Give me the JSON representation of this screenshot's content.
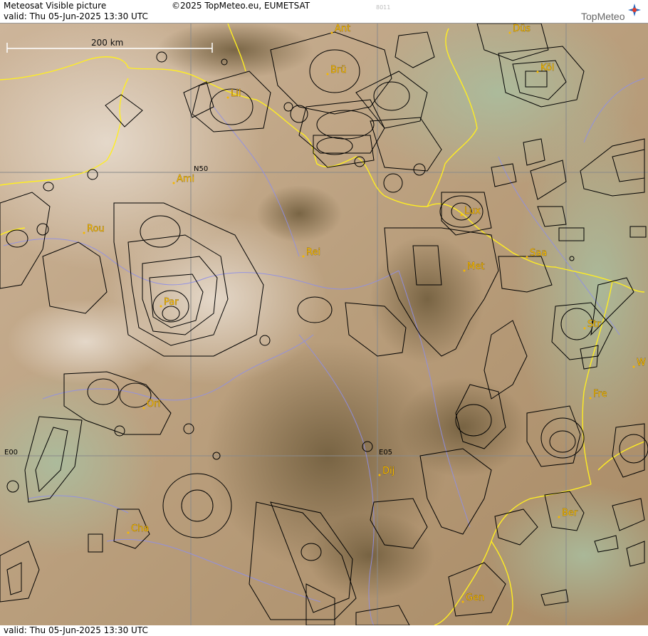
{
  "header": {
    "title": "Meteosat Visible picture",
    "valid": "valid:  Thu  05-Jun-2025  13:30 UTC",
    "copyright": "©2025 TopMeteo.eu, EUMETSAT",
    "code": "8011",
    "logo": "TopMeteo"
  },
  "footer": {
    "valid": "valid:  Thu  05-Jun-2025  13:30 UTC"
  },
  "map": {
    "scale_label": "200 km",
    "grid_labels": [
      "N50",
      "E00",
      "E05"
    ],
    "cities": [
      "Ant",
      "Düs",
      "Brü",
      "Köl",
      "Lil",
      "Ami",
      "Rou",
      "Lux",
      "Rei",
      "Saa",
      "Met",
      "Par",
      "Str",
      "Fre",
      "Orl",
      "Dij",
      "Cha",
      "Ber",
      "Gen",
      "W"
    ]
  },
  "colors": {
    "city_label": "#f5b800",
    "border": "#ffee22",
    "river": "#8f8fe8",
    "airspace": "#000000",
    "grid": "#8a8a8a"
  }
}
